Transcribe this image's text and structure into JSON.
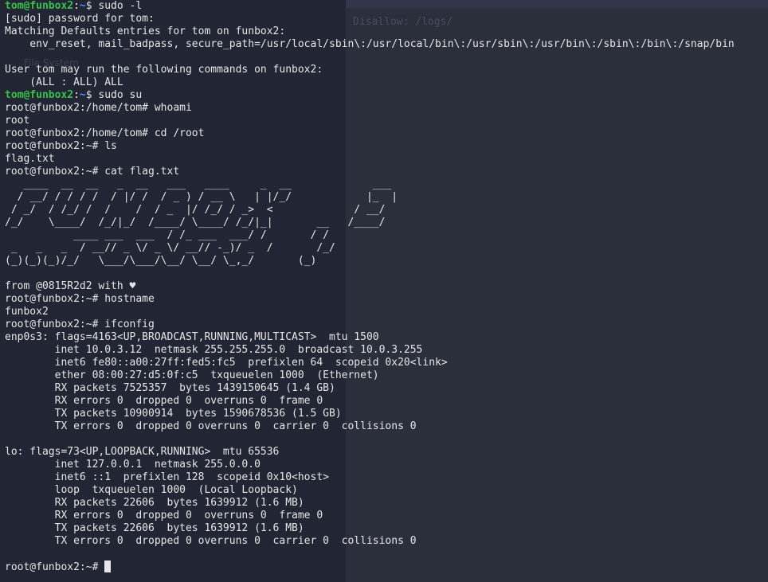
{
  "background_window": {
    "robots_line": "Disallow: /logs/",
    "sidebar_label": "File System"
  },
  "terminal": {
    "lines": [
      {
        "kind": "user_prompt",
        "user": "tom@funbox2",
        "sep": ":",
        "path": "~",
        "end": "$ ",
        "cmd": "sudo -l"
      },
      {
        "kind": "out",
        "text": "[sudo] password for tom:"
      },
      {
        "kind": "out",
        "text": "Matching Defaults entries for tom on funbox2:"
      },
      {
        "kind": "out",
        "text": "    env_reset, mail_badpass, secure_path=/usr/local/sbin\\:/usr/local/bin\\:/usr/sbin\\:/usr/bin\\:/sbin\\:/bin\\:/snap/bin"
      },
      {
        "kind": "out",
        "text": ""
      },
      {
        "kind": "out",
        "text": "User tom may run the following commands on funbox2:"
      },
      {
        "kind": "out",
        "text": "    (ALL : ALL) ALL"
      },
      {
        "kind": "user_prompt",
        "user": "tom@funbox2",
        "sep": ":",
        "path": "~",
        "end": "$ ",
        "cmd": "sudo su"
      },
      {
        "kind": "out",
        "text": "root@funbox2:/home/tom# whoami"
      },
      {
        "kind": "out",
        "text": "root"
      },
      {
        "kind": "out",
        "text": "root@funbox2:/home/tom# cd /root"
      },
      {
        "kind": "out",
        "text": "root@funbox2:~# ls"
      },
      {
        "kind": "out",
        "text": "flag.txt"
      },
      {
        "kind": "out",
        "text": "root@funbox2:~# cat flag.txt"
      },
      {
        "kind": "out",
        "text": "   ____  __  __   _  __   ___   ____     _  __             ___ "
      },
      {
        "kind": "out",
        "text": "  / __/ / / / /  / |/ /  / _ ) / __ \\   | |/_/            |_  |"
      },
      {
        "kind": "out",
        "text": " / _/  / /_/ /  /    /  / _  |/ /_/ / _>  <             / __/ "
      },
      {
        "kind": "out",
        "text": "/_/    \\____/  /_/|_/  /____/ \\____/ /_/|_|       __   /____/  "
      },
      {
        "kind": "out",
        "text": "           ____ ___  ___  / /_ ___  ___/ /       / /           "
      },
      {
        "kind": "out",
        "text": " _   _   _  / __// _ \\/ _ \\/ __// -_)/ _  /       /_/            "
      },
      {
        "kind": "out",
        "text": "(_)(_)(_)/_/   \\___/\\___/\\__/ \\__/ \\_,_/       (_)             "
      },
      {
        "kind": "out",
        "text": ""
      },
      {
        "kind": "out",
        "text": "from @0815R2d2 with ♥"
      },
      {
        "kind": "out",
        "text": "root@funbox2:~# hostname"
      },
      {
        "kind": "out",
        "text": "funbox2"
      },
      {
        "kind": "out",
        "text": "root@funbox2:~# ifconfig"
      },
      {
        "kind": "out",
        "text": "enp0s3: flags=4163<UP,BROADCAST,RUNNING,MULTICAST>  mtu 1500"
      },
      {
        "kind": "out",
        "text": "        inet 10.0.3.12  netmask 255.255.255.0  broadcast 10.0.3.255"
      },
      {
        "kind": "out",
        "text": "        inet6 fe80::a00:27ff:fed5:fc5  prefixlen 64  scopeid 0x20<link>"
      },
      {
        "kind": "out",
        "text": "        ether 08:00:27:d5:0f:c5  txqueuelen 1000  (Ethernet)"
      },
      {
        "kind": "out",
        "text": "        RX packets 7525357  bytes 1439150645 (1.4 GB)"
      },
      {
        "kind": "out",
        "text": "        RX errors 0  dropped 0  overruns 0  frame 0"
      },
      {
        "kind": "out",
        "text": "        TX packets 10900914  bytes 1590678536 (1.5 GB)"
      },
      {
        "kind": "out",
        "text": "        TX errors 0  dropped 0 overruns 0  carrier 0  collisions 0"
      },
      {
        "kind": "out",
        "text": ""
      },
      {
        "kind": "out",
        "text": "lo: flags=73<UP,LOOPBACK,RUNNING>  mtu 65536"
      },
      {
        "kind": "out",
        "text": "        inet 127.0.0.1  netmask 255.0.0.0"
      },
      {
        "kind": "out",
        "text": "        inet6 ::1  prefixlen 128  scopeid 0x10<host>"
      },
      {
        "kind": "out",
        "text": "        loop  txqueuelen 1000  (Local Loopback)"
      },
      {
        "kind": "out",
        "text": "        RX packets 22606  bytes 1639912 (1.6 MB)"
      },
      {
        "kind": "out",
        "text": "        RX errors 0  dropped 0  overruns 0  frame 0"
      },
      {
        "kind": "out",
        "text": "        TX packets 22606  bytes 1639912 (1.6 MB)"
      },
      {
        "kind": "out",
        "text": "        TX errors 0  dropped 0 overruns 0  carrier 0  collisions 0"
      },
      {
        "kind": "out",
        "text": ""
      },
      {
        "kind": "out",
        "text": "root@funbox2:~# ",
        "cursor": true
      }
    ]
  },
  "colors": {
    "background": "#222533",
    "text": "#e6e6e6",
    "user_prompt": "#36c24a",
    "path": "#4f8cf5"
  }
}
